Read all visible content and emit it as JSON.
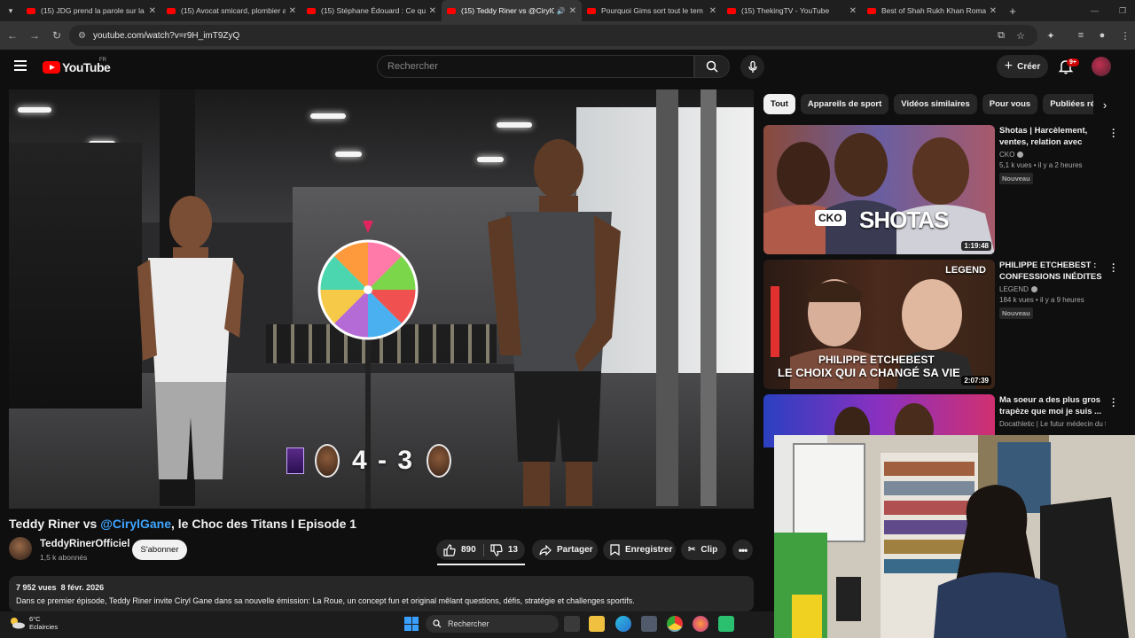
{
  "browser": {
    "tabs": [
      {
        "title": "(15) JDG prend la parole sur la",
        "active": false,
        "audio": false
      },
      {
        "title": "(15) Avocat smicard, plombier a",
        "active": false,
        "audio": false
      },
      {
        "title": "(15) Stéphane Édouard : Ce qui",
        "active": false,
        "audio": false
      },
      {
        "title": "(15) Teddy Riner vs @CirylG",
        "active": true,
        "audio": true
      },
      {
        "title": "Pourquoi Gims sort tout le tem",
        "active": false,
        "audio": false
      },
      {
        "title": "(15) ThekingTV - YouTube",
        "active": false,
        "audio": false
      },
      {
        "title": "Best of Shah Rukh Khan Roma",
        "active": false,
        "audio": false
      }
    ],
    "url": "youtube.com/watch?v=r9H_imT9ZyQ"
  },
  "header": {
    "logo_text": "YouTube",
    "region": "FR",
    "search_placeholder": "Rechercher",
    "create_label": "Créer",
    "notification_count": "9+"
  },
  "player": {
    "score_left": "4",
    "score_sep": "-",
    "score_right": "3"
  },
  "video": {
    "title_prefix": "Teddy Riner vs ",
    "title_mention": "@CirylGane",
    "title_suffix": ", le Choc des Titans I Episode 1",
    "channel_name": "TeddyRinerOfficiel",
    "channel_subs": "1,5 k abonnés",
    "subscribe_label": "S'abonner",
    "likes": "890",
    "dislikes": "13",
    "share_label": "Partager",
    "save_label": "Enregistrer",
    "clip_label": "Clip",
    "views": "7 952 vues",
    "date": "8 févr. 2026",
    "description": "Dans ce premier épisode, Teddy Riner invite Ciryl Gane dans sa nouvelle émission: La Roue, un concept fun et original mêlant questions, défis, stratégie et challenges sportifs."
  },
  "chips": [
    "Tout",
    "Appareils de sport",
    "Vidéos similaires",
    "Pour vous",
    "Publiées récem"
  ],
  "recommended": [
    {
      "title": "Shotas | Harcèlement, ventes, relation avec Koba,...",
      "channel": "CKO",
      "meta": "5,1 k vues • il y a 2 heures",
      "badge": "Nouveau",
      "duration": "1:19:48",
      "thumb_text": "SHOTAS",
      "thumb_logo": "CKO"
    },
    {
      "title": "PHILIPPE ETCHEBEST : CONFESSIONS INÉDITES ...",
      "channel": "LEGEND",
      "meta": "184 k vues • il y a 9 heures",
      "badge": "Nouveau",
      "duration": "2:07:39",
      "thumb_line1": "PHILIPPE ETCHEBEST",
      "thumb_line2": "LE CHOIX QUI A CHANGÉ SA VIE",
      "thumb_logo": "LEGEND"
    },
    {
      "title": "Ma soeur a des plus gros trapèze que moi je suis ...",
      "channel": "Docathletic | Le futur médecin du fit...",
      "meta": "",
      "badge": "",
      "duration": ""
    }
  ],
  "taskbar": {
    "temperature": "6°C",
    "weather": "Eclaircies",
    "search_label": "Rechercher"
  },
  "colors": {
    "background": "#0f0f0f",
    "yt_red": "#ff0000",
    "mention_blue": "#3ea6ff",
    "chip_bg": "#272727"
  }
}
